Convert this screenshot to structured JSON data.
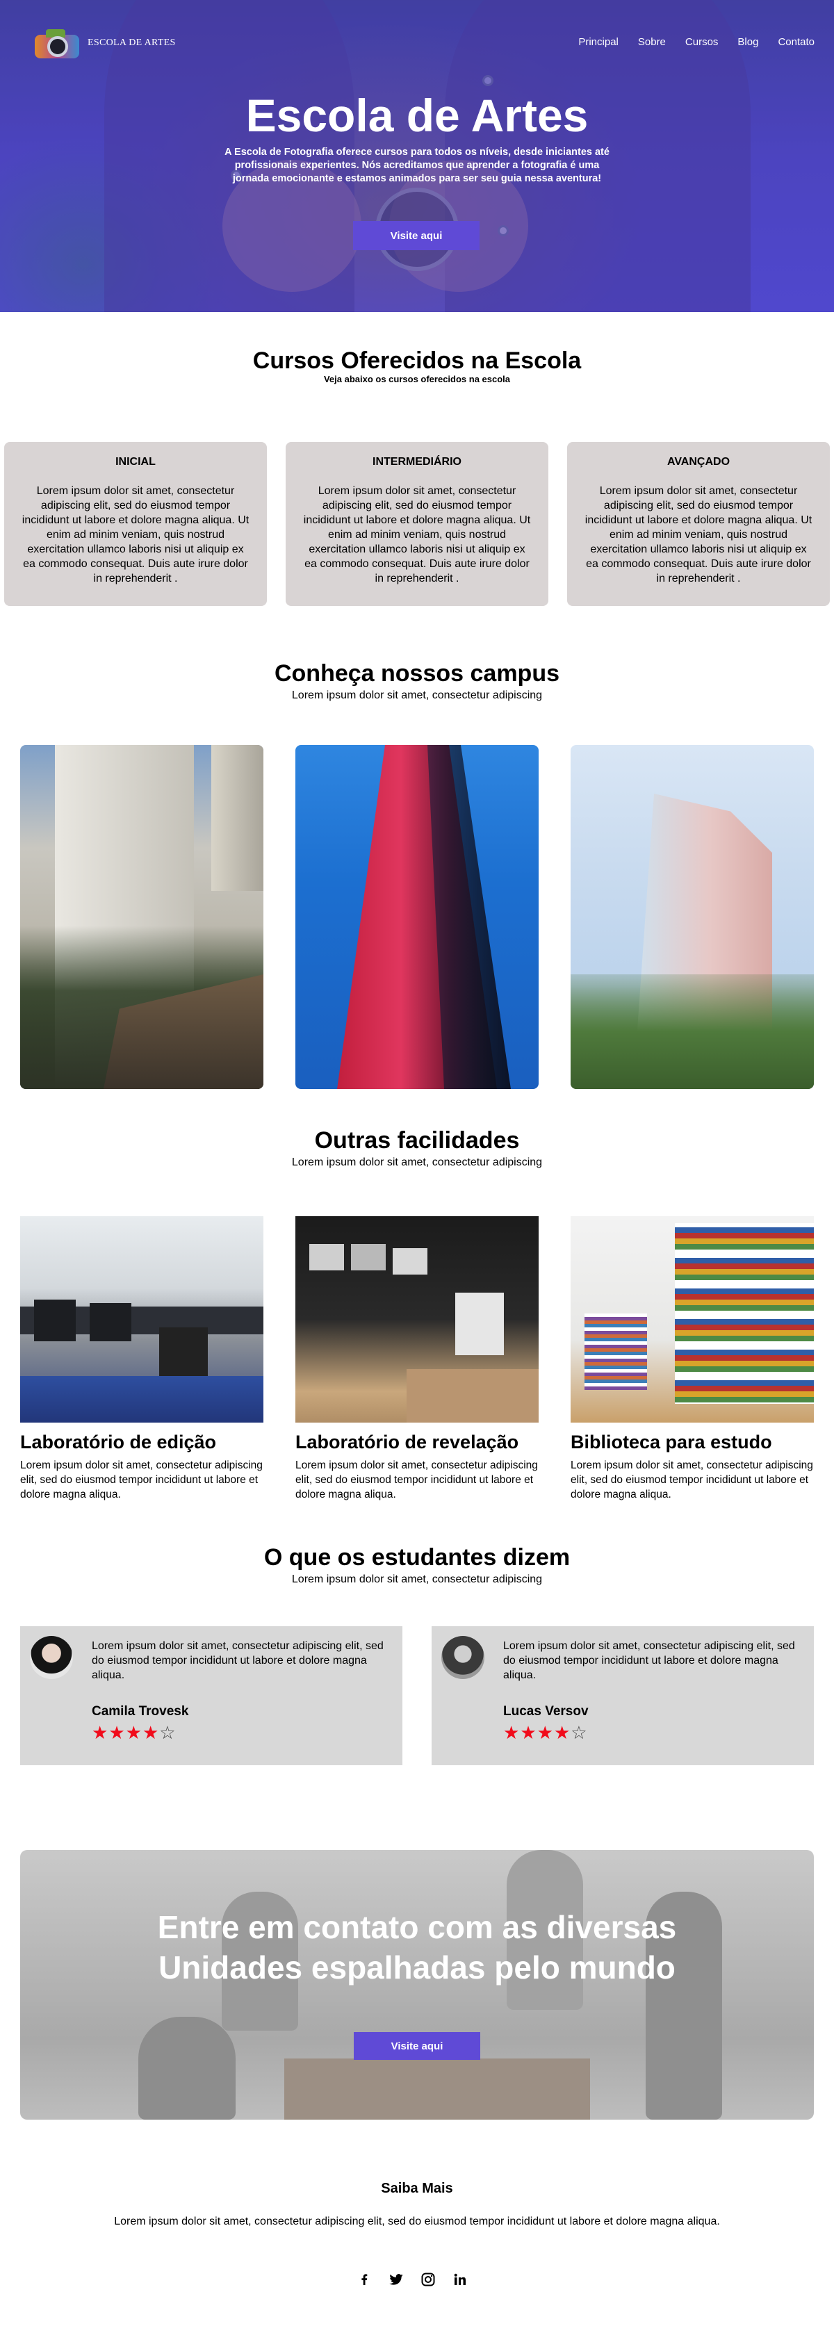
{
  "brand": {
    "name": "ESCOLA DE ARTES"
  },
  "nav": {
    "items": [
      {
        "label": "Principal"
      },
      {
        "label": "Sobre"
      },
      {
        "label": "Cursos"
      },
      {
        "label": "Blog"
      },
      {
        "label": "Contato"
      }
    ]
  },
  "hero": {
    "title": "Escola de Artes",
    "text": "A Escola de Fotografia oferece cursos para todos os níveis, desde iniciantes até profissionais experientes. Nós acreditamos que aprender a fotografia é uma jornada emocionante e estamos animados para ser seu guia nessa aventura!",
    "button": "Visite aqui"
  },
  "courses": {
    "title": "Cursos Oferecidos na Escola",
    "subtitle": "Veja abaixo os cursos oferecidos na escola",
    "items": [
      {
        "level": "INICIAL",
        "text": "Lorem ipsum dolor sit amet, consectetur adipiscing elit, sed do eiusmod tempor incididunt ut labore et dolore magna aliqua. Ut enim ad minim veniam, quis nostrud exercitation ullamco laboris nisi ut aliquip ex ea commodo consequat. Duis aute irure dolor in reprehenderit ."
      },
      {
        "level": "INTERMEDIÁRIO",
        "text": "Lorem ipsum dolor sit amet, consectetur adipiscing elit, sed do eiusmod tempor incididunt ut labore et dolore magna aliqua. Ut enim ad minim veniam, quis nostrud exercitation ullamco laboris nisi ut aliquip ex ea commodo consequat. Duis aute irure dolor in reprehenderit ."
      },
      {
        "level": "AVANÇADO",
        "text": "Lorem ipsum dolor sit amet, consectetur adipiscing elit, sed do eiusmod tempor incididunt ut labore et dolore magna aliqua. Ut enim ad minim veniam, quis nostrud exercitation ullamco laboris nisi ut aliquip ex ea commodo consequat. Duis aute irure dolor in reprehenderit ."
      }
    ]
  },
  "campus": {
    "title": "Conheça nossos campus",
    "subtitle": "Lorem ipsum dolor sit amet, consectetur adipiscing"
  },
  "facilities": {
    "title": "Outras facilidades",
    "subtitle": "Lorem ipsum dolor sit amet, consectetur adipiscing",
    "items": [
      {
        "title": "Laboratório de edição",
        "text": "Lorem ipsum dolor sit amet, consectetur adipiscing elit, sed do eiusmod tempor incididunt ut labore et dolore magna aliqua."
      },
      {
        "title": "Laboratório de revelação",
        "text": "Lorem ipsum dolor sit amet, consectetur adipiscing elit, sed do eiusmod tempor incididunt ut labore et dolore magna aliqua."
      },
      {
        "title": "Biblioteca para estudo",
        "text": "Lorem ipsum dolor sit amet, consectetur adipiscing elit, sed do eiusmod tempor incididunt ut labore et dolore magna aliqua."
      }
    ]
  },
  "testimonials": {
    "title": "O que os estudantes dizem",
    "subtitle": "Lorem ipsum dolor sit amet, consectetur adipiscing",
    "items": [
      {
        "text": "Lorem ipsum dolor sit amet, consectetur adipiscing elit, sed do eiusmod tempor incididunt ut labore et dolore magna aliqua.",
        "name": "Camila Trovesk",
        "rating": 4,
        "max": 5
      },
      {
        "text": "Lorem ipsum dolor sit amet, consectetur adipiscing elit, sed do eiusmod tempor incididunt ut labore et dolore magna aliqua.",
        "name": "Lucas Versov",
        "rating": 4,
        "max": 5
      }
    ]
  },
  "contact": {
    "title_line1": "Entre em contato com as diversas",
    "title_line2": "Unidades espalhadas pelo mundo",
    "button": "Visite aqui"
  },
  "footer": {
    "title": "Saiba Mais",
    "text": "Lorem ipsum dolor sit amet, consectetur adipiscing elit, sed do eiusmod tempor incididunt ut labore et dolore magna aliqua.",
    "socials": [
      "facebook-icon",
      "twitter-icon",
      "instagram-icon",
      "linkedin-icon"
    ]
  },
  "colors": {
    "accent": "#5f4ad6",
    "hero_overlay": "#4b43b6",
    "card_bg": "#d9d4d4",
    "testimonial_bg": "#d8d8d8",
    "star": "#f10b1b"
  }
}
